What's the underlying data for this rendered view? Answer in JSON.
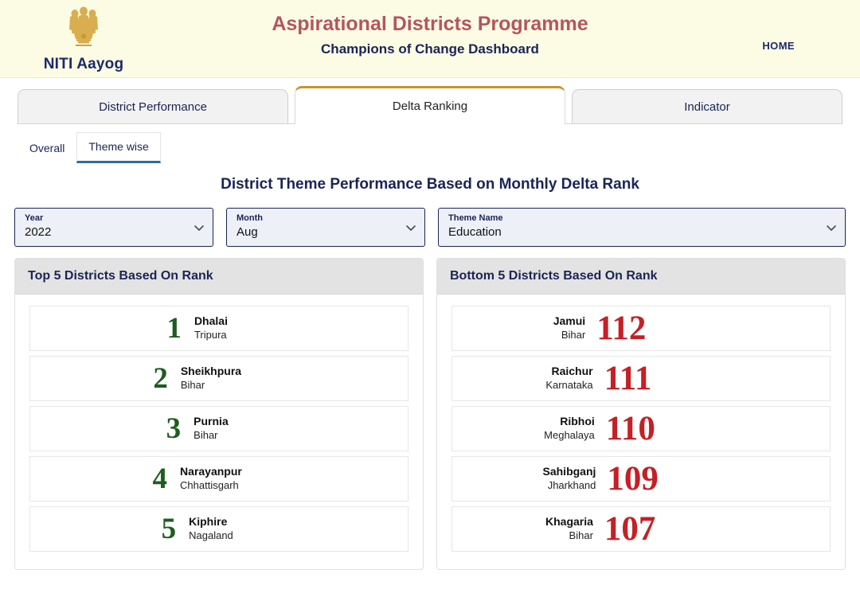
{
  "header": {
    "brand_name": "NITI Aayog",
    "emblem_icon": "ashoka-emblem-icon",
    "title": "Aspirational Districts Programme",
    "subtitle": "Champions of Change Dashboard",
    "home_label": "HOME",
    "colors": {
      "background": "#fcfce4",
      "title": "#b4555f",
      "subtitle": "#1a2456",
      "brand": "#1a2a6c"
    }
  },
  "tabs": [
    {
      "label": "District Performance",
      "active": false
    },
    {
      "label": "Delta Ranking",
      "active": true
    },
    {
      "label": "Indicator",
      "active": false
    }
  ],
  "subtabs": [
    {
      "label": "Overall",
      "active": false
    },
    {
      "label": "Theme wise",
      "active": true
    }
  ],
  "page_title": "District Theme Performance Based on Monthly Delta Rank",
  "filters": [
    {
      "label": "Year",
      "value": "2022",
      "icon": "chevron-down-icon"
    },
    {
      "label": "Month",
      "value": "Aug",
      "icon": "chevron-down-icon"
    },
    {
      "label": "Theme Name",
      "value": "Education",
      "icon": "chevron-down-icon"
    }
  ],
  "top_panel": {
    "title": "Top 5 Districts Based On Rank",
    "rank_color": "#1f5c20",
    "rows": [
      {
        "rank": "1",
        "district": "Dhalai",
        "state": "Tripura"
      },
      {
        "rank": "2",
        "district": "Sheikhpura",
        "state": "Bihar"
      },
      {
        "rank": "3",
        "district": "Purnia",
        "state": "Bihar"
      },
      {
        "rank": "4",
        "district": "Narayanpur",
        "state": "Chhattisgarh"
      },
      {
        "rank": "5",
        "district": "Kiphire",
        "state": "Nagaland"
      }
    ]
  },
  "bottom_panel": {
    "title": "Bottom 5 Districts Based On Rank",
    "rank_color": "#c42026",
    "rows": [
      {
        "rank": "112",
        "district": "Jamui",
        "state": "Bihar"
      },
      {
        "rank": "111",
        "district": "Raichur",
        "state": "Karnataka"
      },
      {
        "rank": "110",
        "district": "Ribhoi",
        "state": "Meghalaya"
      },
      {
        "rank": "109",
        "district": "Sahibganj",
        "state": "Jharkhand"
      },
      {
        "rank": "107",
        "district": "Khagaria",
        "state": "Bihar"
      }
    ]
  }
}
